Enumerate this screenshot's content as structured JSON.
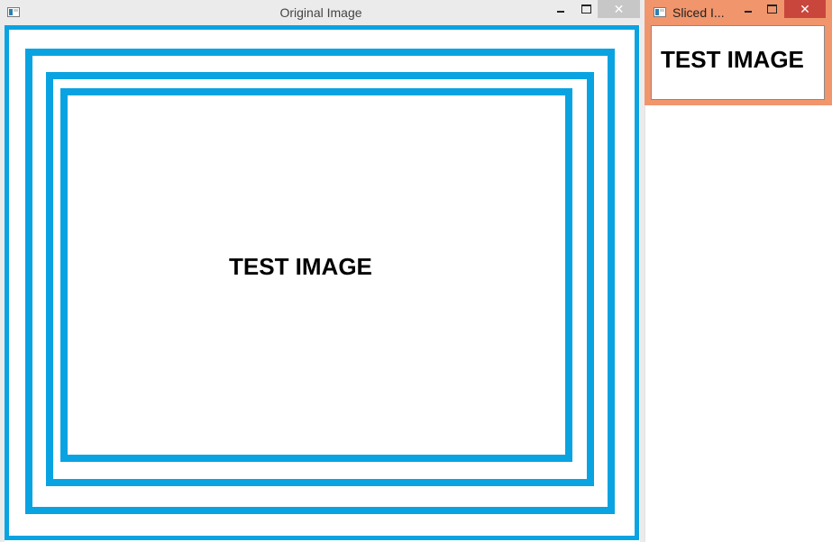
{
  "windows": {
    "original": {
      "title": "Original Image",
      "close_label": "✕",
      "image_text": "TEST IMAGE"
    },
    "sliced": {
      "title": "Sliced I...",
      "close_label": "✕",
      "image_text": "TEST IMAGE"
    }
  },
  "icons": {
    "app": "app-window-icon",
    "minimize": "minimize-icon",
    "maximize": "maximize-icon",
    "close": "close-icon"
  },
  "colors": {
    "frame_blue": "#0aa3e2",
    "sliced_titlebar": "#f0956c",
    "sliced_close": "#c9463d",
    "original_close": "#c7c7c7",
    "titlebar_inactive": "#ebebeb"
  }
}
